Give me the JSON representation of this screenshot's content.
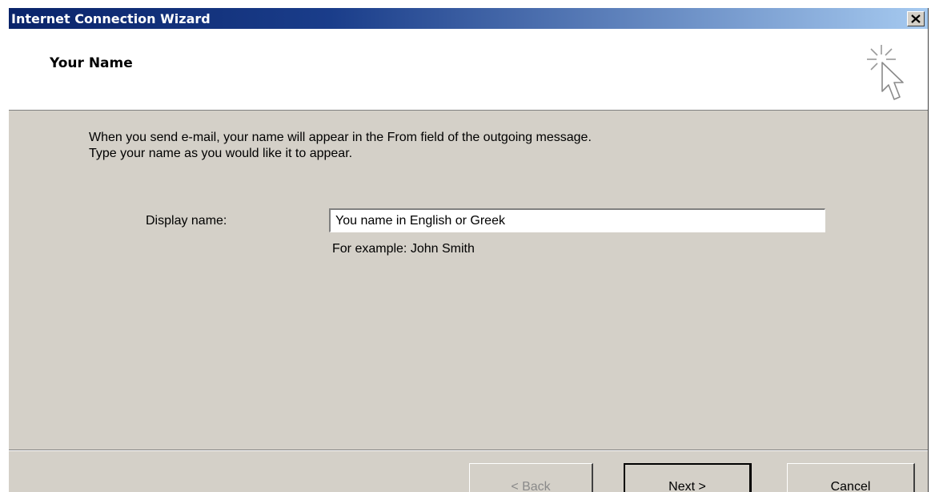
{
  "window": {
    "title": "Internet Connection Wizard",
    "close_glyph": "✕"
  },
  "header": {
    "page_title": "Your Name",
    "icon": "wizard-cursor-sparkle-icon"
  },
  "body": {
    "instruction_line1": "When you send e-mail, your name will appear in the From field of the outgoing message.",
    "instruction_line2": "Type your name as you would like it to appear."
  },
  "form": {
    "display_name_label": "Display name:",
    "display_name_value": "You name in English or Greek",
    "example_text": "For example: John Smith"
  },
  "buttons": {
    "back_label": "< Back",
    "back_enabled": false,
    "next_label": "Next >",
    "cancel_label": "Cancel"
  },
  "colors": {
    "title_bar_start": "#0a246a",
    "title_bar_end": "#a6caf0",
    "dialog_face": "#d4d0c8",
    "header_background": "#ffffff"
  }
}
